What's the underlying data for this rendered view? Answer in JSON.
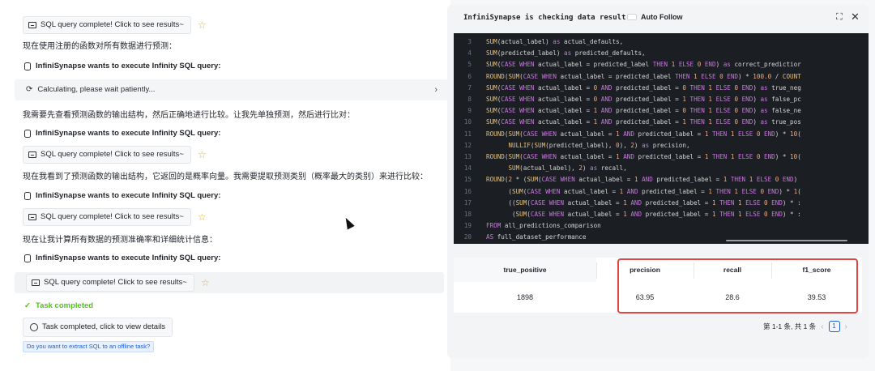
{
  "chat": {
    "sql_chip_label": "SQL query complete! Click to see results~",
    "exec_label": "InfiniSynapse wants to execute Infinity SQL query:",
    "msg1": "现在使用注册的函数对所有数据进行预测：",
    "calc_label": "Calculating, please wait patiently...",
    "msg2": "我需要先查看预测函数的输出结构，然后正确地进行比较。让我先单独预测，然后进行比对：",
    "msg3": "现在我看到了预测函数的输出结构，它返回的是概率向量。我需要提取预测类别（概率最大的类别）来进行比较：",
    "msg4": "现在让我计算所有数据的预测准确率和详细统计信息：",
    "task_completed": "Task completed",
    "view_details": "Task completed, click to view details",
    "offline_prompt": "Do you want to extract SQL to an offline task?"
  },
  "panel": {
    "title": "InfiniSynapse is checking data result",
    "auto_follow": "Auto Follow",
    "code_lines": [
      {
        "no": "3",
        "text": "SUM(actual_label) as actual_defaults,"
      },
      {
        "no": "4",
        "text": "SUM(predicted_label) as predicted_defaults,"
      },
      {
        "no": "5",
        "text": "SUM(CASE WHEN actual_label = predicted_label THEN 1 ELSE 0 END) as correct_predictior"
      },
      {
        "no": "6",
        "text": "ROUND(SUM(CASE WHEN actual_label = predicted_label THEN 1 ELSE 0 END) * 100.0 / COUNT"
      },
      {
        "no": "7",
        "text": "SUM(CASE WHEN actual_label = 0 AND predicted_label = 0 THEN 1 ELSE 0 END) as true_neg"
      },
      {
        "no": "8",
        "text": "SUM(CASE WHEN actual_label = 0 AND predicted_label = 1 THEN 1 ELSE 0 END) as false_pc"
      },
      {
        "no": "9",
        "text": "SUM(CASE WHEN actual_label = 1 AND predicted_label = 0 THEN 1 ELSE 0 END) as false_ne"
      },
      {
        "no": "10",
        "text": "SUM(CASE WHEN actual_label = 1 AND predicted_label = 1 THEN 1 ELSE 0 END) as true_pos"
      },
      {
        "no": "11",
        "text": "ROUND(SUM(CASE WHEN actual_label = 1 AND predicted_label = 1 THEN 1 ELSE 0 END) * 10("
      },
      {
        "no": "12",
        "text": "      NULLIF(SUM(predicted_label), 0), 2) as precision,"
      },
      {
        "no": "13",
        "text": "ROUND(SUM(CASE WHEN actual_label = 1 AND predicted_label = 1 THEN 1 ELSE 0 END) * 10("
      },
      {
        "no": "14",
        "text": "      SUM(actual_label), 2) as recall,"
      },
      {
        "no": "15",
        "text": "ROUND(2 * (SUM(CASE WHEN actual_label = 1 AND predicted_label = 1 THEN 1 ELSE 0 END)"
      },
      {
        "no": "16",
        "text": "      (SUM(CASE WHEN actual_label = 1 AND predicted_label = 1 THEN 1 ELSE 0 END) * 1("
      },
      {
        "no": "17",
        "text": "      ((SUM(CASE WHEN actual_label = 1 AND predicted_label = 1 THEN 1 ELSE 0 END) * :"
      },
      {
        "no": "18",
        "text": "       (SUM(CASE WHEN actual_label = 1 AND predicted_label = 1 THEN 1 ELSE 0 END) * :"
      },
      {
        "no": "19",
        "text": "FROM all_predictions_comparison"
      },
      {
        "no": "20",
        "text": "AS full_dataset_performance"
      }
    ],
    "table": {
      "headers": [
        "true_positive",
        "precision",
        "recall",
        "f1_score"
      ],
      "row": [
        "1898",
        "63.95",
        "28.6",
        "39.53"
      ]
    },
    "pager_text": "第 1-1 条, 共 1 条",
    "page": "1"
  }
}
